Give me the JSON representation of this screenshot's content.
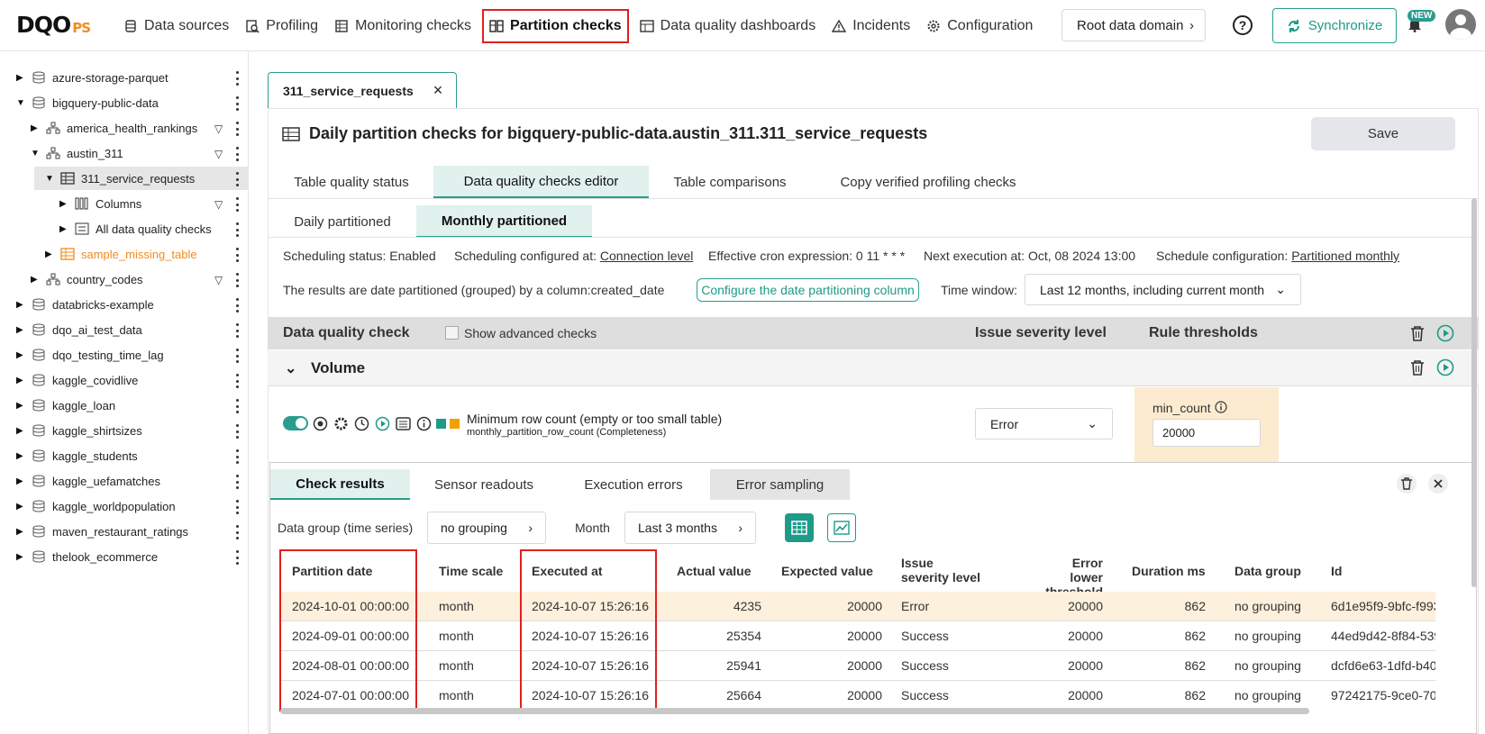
{
  "app": {
    "logo_main": "DQO",
    "logo_suffix": "PS"
  },
  "nav": {
    "items": [
      {
        "label": "Data sources",
        "icon": "data-sources-icon"
      },
      {
        "label": "Profiling",
        "icon": "profiling-icon"
      },
      {
        "label": "Monitoring checks",
        "icon": "monitoring-icon"
      },
      {
        "label": "Partition checks",
        "icon": "partition-icon"
      },
      {
        "label": "Data quality dashboards",
        "icon": "dashboard-icon"
      },
      {
        "label": "Incidents",
        "icon": "warning-icon"
      },
      {
        "label": "Configuration",
        "icon": "gear-icon"
      }
    ],
    "active": "Partition checks"
  },
  "header": {
    "root_domain": "Root data domain",
    "help": "?",
    "sync": "Synchronize",
    "new_badge": "NEW"
  },
  "tree": [
    {
      "label": "azure-storage-parquet"
    },
    {
      "label": "bigquery-public-data"
    },
    {
      "label": "america_health_rankings"
    },
    {
      "label": "austin_311"
    },
    {
      "label": "311_service_requests"
    },
    {
      "label": "Columns"
    },
    {
      "label": "All data quality checks"
    },
    {
      "label": "sample_missing_table"
    },
    {
      "label": "country_codes"
    },
    {
      "label": "databricks-example"
    },
    {
      "label": "dqo_ai_test_data"
    },
    {
      "label": "dqo_testing_time_lag"
    },
    {
      "label": "kaggle_covidlive"
    },
    {
      "label": "kaggle_loan"
    },
    {
      "label": "kaggle_shirtsizes"
    },
    {
      "label": "kaggle_students"
    },
    {
      "label": "kaggle_uefamatches"
    },
    {
      "label": "kaggle_worldpopulation"
    },
    {
      "label": "maven_restaurant_ratings"
    },
    {
      "label": "thelook_ecommerce"
    }
  ],
  "editor": {
    "tab_label": "311_service_requests",
    "title": "Daily partition checks for bigquery-public-data.austin_311.311_service_requests",
    "save": "Save",
    "tabs": [
      "Table quality status",
      "Data quality checks editor",
      "Table comparisons",
      "Copy verified profiling checks"
    ],
    "subtabs": [
      "Daily partitioned",
      "Monthly partitioned"
    ],
    "scheduling_status": "Scheduling status: Enabled",
    "sched_configured_label": "Scheduling configured at: ",
    "sched_configured_link": "Connection level",
    "cron": "Effective cron expression: 0 11 * * *",
    "next_exec": "Next execution at: Oct, 08 2024 13:00",
    "sched_cfg_label": "Schedule configuration: ",
    "sched_cfg_link": "Partitioned monthly",
    "partition_text": "The results are date partitioned (grouped) by a column:created_date",
    "config_btn": "Configure the date partitioning column",
    "time_window_label": "Time window:",
    "time_window_value": "Last 12 months, including current month",
    "col_check": "Data quality check",
    "show_advanced": "Show advanced checks",
    "col_severity": "Issue severity level",
    "col_thresholds": "Rule thresholds",
    "category": "Volume",
    "check_name": "Minimum row count (empty or too small table)",
    "check_sub": "monthly_partition_row_count (Completeness)",
    "severity": "Error",
    "threshold_label": "min_count",
    "threshold_value": "20000"
  },
  "results": {
    "tabs": [
      "Check results",
      "Sensor readouts",
      "Execution errors",
      "Error sampling"
    ],
    "group_label": "Data group (time series)",
    "group_value": "no grouping",
    "month_label": "Month",
    "month_value": "Last 3 months",
    "columns": [
      "Partition date",
      "Time scale",
      "Executed at",
      "Actual value",
      "Expected value",
      "Issue",
      "severity level",
      "Error",
      "lower threshold",
      "Duration ms",
      "Data group",
      "Id"
    ],
    "rows": [
      {
        "partition_date": "2024-10-01 00:00:00",
        "time_scale": "month",
        "executed_at": "2024-10-07 15:26:16",
        "actual": "4235",
        "expected": "20000",
        "severity": "Error",
        "lower": "20000",
        "duration": "862",
        "group": "no grouping",
        "id": "6d1e95f9-9bfc-f993"
      },
      {
        "partition_date": "2024-09-01 00:00:00",
        "time_scale": "month",
        "executed_at": "2024-10-07 15:26:16",
        "actual": "25354",
        "expected": "20000",
        "severity": "Success",
        "lower": "20000",
        "duration": "862",
        "group": "no grouping",
        "id": "44ed9d42-8f84-539"
      },
      {
        "partition_date": "2024-08-01 00:00:00",
        "time_scale": "month",
        "executed_at": "2024-10-07 15:26:16",
        "actual": "25941",
        "expected": "20000",
        "severity": "Success",
        "lower": "20000",
        "duration": "862",
        "group": "no grouping",
        "id": "dcfd6e63-1dfd-b40"
      },
      {
        "partition_date": "2024-07-01 00:00:00",
        "time_scale": "month",
        "executed_at": "2024-10-07 15:26:16",
        "actual": "25664",
        "expected": "20000",
        "severity": "Success",
        "lower": "20000",
        "duration": "862",
        "group": "no grouping",
        "id": "97242175-9ce0-70"
      }
    ]
  },
  "colors": {
    "accent": "#2a9d8f",
    "highlight_red": "#e02020",
    "orange": "#f08c1e",
    "error_row": "#fdf0dc",
    "threshold_bg": "#fdebd0"
  }
}
